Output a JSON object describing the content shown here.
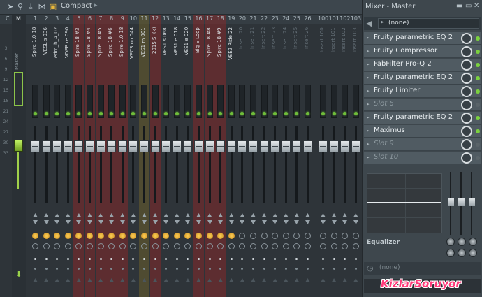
{
  "toolbar": {
    "mode_label": "Compact",
    "icons": [
      "arrow-icon",
      "link-icon",
      "download-icon",
      "butterfly-icon",
      "layout-icon"
    ]
  },
  "master": {
    "header_c": "C",
    "header_m": "M",
    "label": "Master",
    "scale": [
      "3",
      "6",
      "9",
      "12",
      "15",
      "18",
      "21",
      "24",
      "27",
      "30",
      "33"
    ]
  },
  "strips": [
    {
      "num": "1",
      "name": "Spire 1.0.18",
      "tint": "none"
    },
    {
      "num": "2",
      "name": "VESL s 036",
      "tint": "none"
    },
    {
      "num": "3",
      "name": "edm_b_A_02",
      "tint": "none"
    },
    {
      "num": "4",
      "name": "VDEB re 090",
      "tint": "none"
    },
    {
      "num": "5",
      "name": "Spire 18 #3",
      "tint": "red"
    },
    {
      "num": "6",
      "name": "Spire 18 #4",
      "tint": "red"
    },
    {
      "num": "7",
      "name": "Spire 18 #5",
      "tint": "red"
    },
    {
      "num": "8",
      "name": "Spire 18 #6",
      "tint": "red"
    },
    {
      "num": "9",
      "name": "Spire 1.0.18",
      "tint": "red"
    },
    {
      "num": "10",
      "name": "VEC3 on 044",
      "tint": "none"
    },
    {
      "num": "11",
      "name": "VES1 m 001",
      "tint": "olive"
    },
    {
      "num": "12",
      "name": "2015 S. (k)",
      "tint": "red"
    },
    {
      "num": "13",
      "name": "VES1 s 068",
      "tint": "none"
    },
    {
      "num": "14",
      "name": "VES1 e 018",
      "tint": "none"
    },
    {
      "num": "15",
      "name": "VES1 e 020",
      "tint": "none"
    },
    {
      "num": "16",
      "name": "Big E Loop",
      "tint": "red"
    },
    {
      "num": "17",
      "name": "Spire 18 #8",
      "tint": "red"
    },
    {
      "num": "18",
      "name": "Spire 18 #9",
      "tint": "red"
    },
    {
      "num": "19",
      "name": "VEE2 Ride 22",
      "tint": "none"
    },
    {
      "num": "20",
      "name": "Insert 20",
      "tint": "none"
    },
    {
      "num": "21",
      "name": "Insert 21",
      "tint": "none"
    },
    {
      "num": "22",
      "name": "Insert 22",
      "tint": "none"
    },
    {
      "num": "23",
      "name": "Insert 23",
      "tint": "none"
    },
    {
      "num": "24",
      "name": "Insert 24",
      "tint": "none"
    },
    {
      "num": "25",
      "name": "Insert 25",
      "tint": "none"
    },
    {
      "num": "26",
      "name": "Insert 26",
      "tint": "none"
    },
    {
      "num": "100",
      "name": "Insert 100",
      "tint": "none"
    },
    {
      "num": "101",
      "name": "Insert 101",
      "tint": "none"
    },
    {
      "num": "102",
      "name": "Insert 102",
      "tint": "none"
    },
    {
      "num": "103",
      "name": "Insert 103",
      "tint": "none"
    }
  ],
  "panel": {
    "title": "Mixer - Master",
    "input": "(none)",
    "slots": [
      {
        "label": "Fruity parametric EQ 2",
        "empty": false,
        "on": true
      },
      {
        "label": "Fruity Compressor",
        "empty": false,
        "on": true
      },
      {
        "label": "FabFilter Pro-Q 2",
        "empty": false,
        "on": true
      },
      {
        "label": "Fruity parametric EQ 2",
        "empty": false,
        "on": true
      },
      {
        "label": "Fruity Limiter",
        "empty": false,
        "on": true
      },
      {
        "label": "Slot 6",
        "empty": true,
        "on": false
      },
      {
        "label": "Fruity parametric EQ 2",
        "empty": false,
        "on": true
      },
      {
        "label": "Maximus",
        "empty": false,
        "on": true
      },
      {
        "label": "Slot 9",
        "empty": true,
        "on": false
      },
      {
        "label": "Slot 10",
        "empty": true,
        "on": false
      }
    ],
    "eq_label": "Equalizer",
    "output": "(none)",
    "colors": {
      "active_dot": "#7bd13f",
      "highlight_red": "#962626",
      "master_green": "#a0d04a"
    }
  },
  "watermark": "KizlarSoruyor"
}
